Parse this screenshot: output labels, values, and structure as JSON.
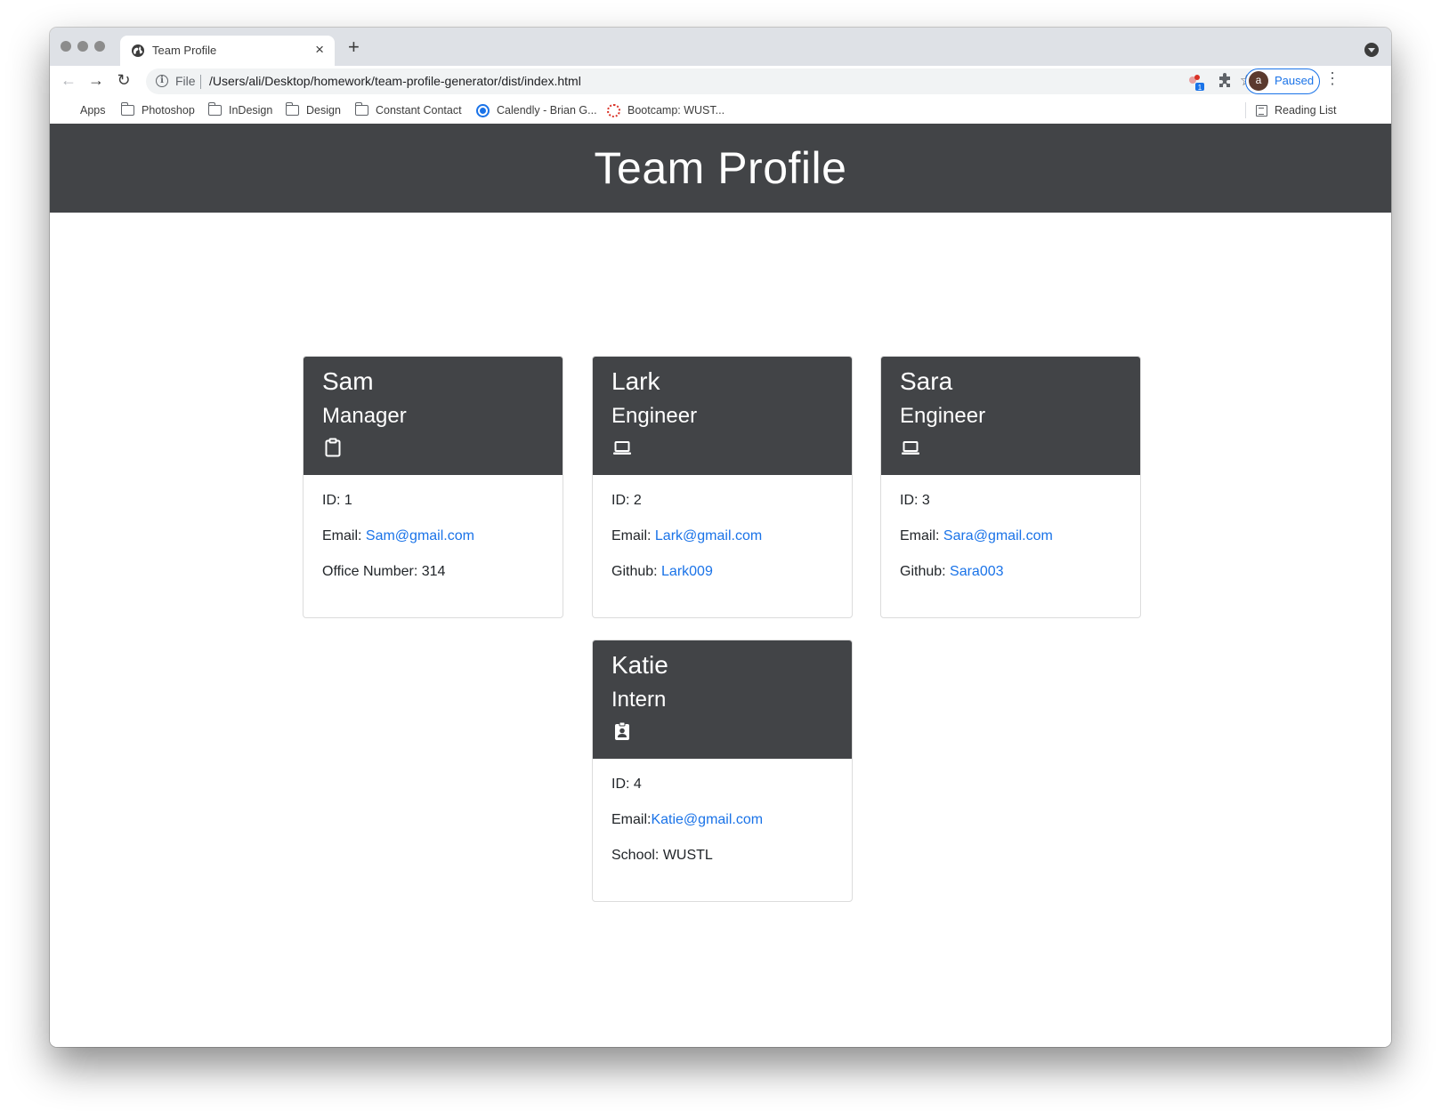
{
  "browser": {
    "tab_title": "Team Profile",
    "new_tab_label": "+",
    "close_label": "×",
    "scheme_label": "File",
    "url": "/Users/ali/Desktop/homework/team-profile-generator/dist/index.html",
    "profile_initial": "a",
    "profile_status": "Paused",
    "extension_badge": "1"
  },
  "bookmarks": [
    {
      "label": "Apps",
      "icon": "apps-grid-icon"
    },
    {
      "label": "Photoshop",
      "icon": "folder-icon"
    },
    {
      "label": "InDesign",
      "icon": "folder-icon"
    },
    {
      "label": "Design",
      "icon": "folder-icon"
    },
    {
      "label": "Constant Contact",
      "icon": "folder-icon"
    },
    {
      "label": "Calendly - Brian G...",
      "icon": "calendly-icon"
    },
    {
      "label": "Bootcamp: WUST...",
      "icon": "bootcamp-icon"
    }
  ],
  "reading_list": "Reading List",
  "page": {
    "title": "Team Profile"
  },
  "colors": {
    "header_bg": "#424447",
    "link": "#1a73e8",
    "accent": "#1a73e8"
  },
  "cards": [
    {
      "name": "Sam",
      "role": "Manager",
      "icon": "clipboard-icon",
      "id_text": "ID: 1",
      "email_label": "Email: ",
      "email": "Sam@gmail.com",
      "extra_label": "Office Number: 314",
      "extra_link": ""
    },
    {
      "name": "Lark",
      "role": "Engineer",
      "icon": "laptop-icon",
      "id_text": "ID: 2",
      "email_label": "Email: ",
      "email": "Lark@gmail.com",
      "extra_label": "Github: ",
      "extra_link": "Lark009"
    },
    {
      "name": "Sara",
      "role": "Engineer",
      "icon": "laptop-icon",
      "id_text": "ID: 3",
      "email_label": "Email: ",
      "email": "Sara@gmail.com",
      "extra_label": "Github: ",
      "extra_link": "Sara003"
    },
    {
      "name": "Katie",
      "role": "Intern",
      "icon": "id-badge-icon",
      "id_text": "ID: 4",
      "email_label": "Email:",
      "email": "Katie@gmail.com",
      "extra_label": "School: WUSTL",
      "extra_link": ""
    }
  ]
}
